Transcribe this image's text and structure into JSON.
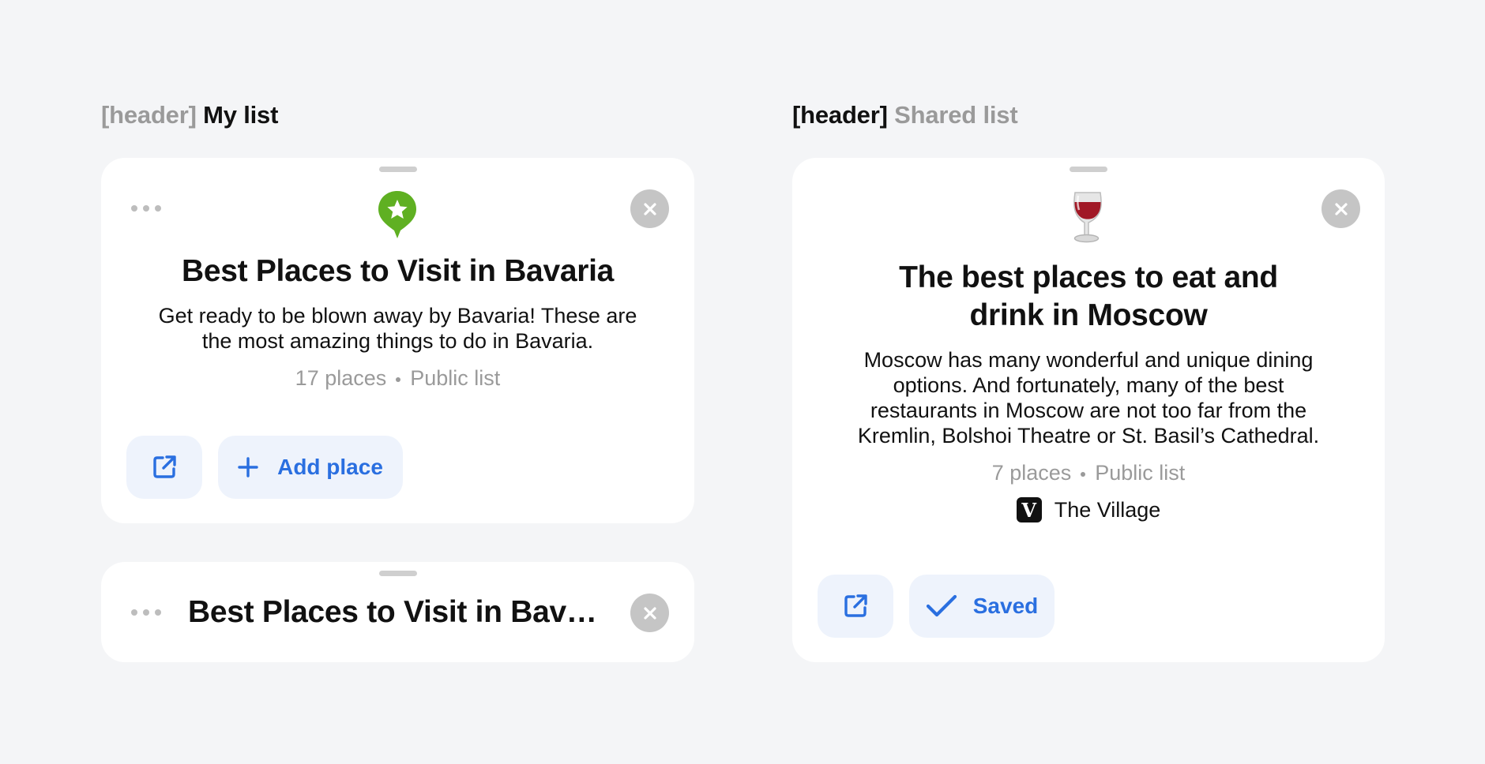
{
  "my_list_section": {
    "bracket": "[header]",
    "label": "My list"
  },
  "shared_list_section": {
    "bracket": "[header]",
    "label": "Shared list"
  },
  "my_list_card": {
    "icon": "green-star-pin-icon",
    "title": "Best Places to Visit in Bavaria",
    "description": "Get ready to be blown away by Bavaria! These are the most amazing things to do in Bavaria.",
    "places_count": "17 places",
    "visibility": "Public list",
    "add_place_label": "Add place"
  },
  "my_list_collapsed": {
    "title": "Best Places to Visit in Bava..."
  },
  "shared_list_card": {
    "icon": "wine-glass-icon",
    "title_line1": "The best places to eat and",
    "title_line2": "drink in Moscow",
    "description": "Moscow has many wonderful and unique dining options. And fortunately, many of the best restaurants in Moscow are not too far from the Kremlin, Bolshoi Theatre or St. Basil’s Cathedral.",
    "places_count": "7 places",
    "visibility": "Public list",
    "source_logo": "V",
    "source_name": "The Village",
    "saved_label": "Saved"
  },
  "colors": {
    "accent": "#2a6fe0",
    "button_bg": "#eef3fc",
    "close_bg": "#c5c5c5",
    "pin_green": "#5fb022",
    "background": "#f4f5f7"
  }
}
